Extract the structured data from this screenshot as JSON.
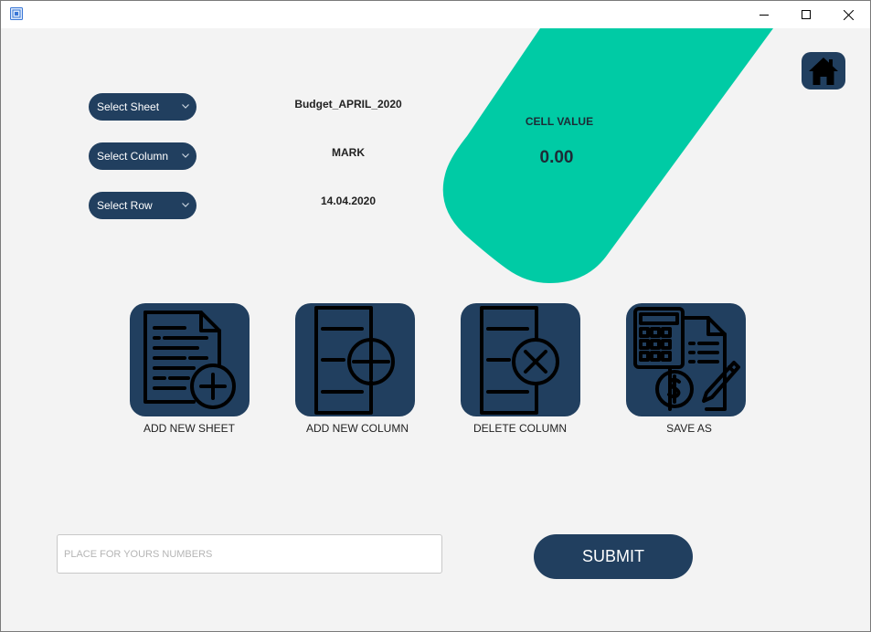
{
  "window": {
    "app_icon": "app-window-icon"
  },
  "selectors": [
    {
      "label": "Select Sheet",
      "value": "Budget_APRIL_2020"
    },
    {
      "label": "Select Column",
      "value": "MARK"
    },
    {
      "label": "Select Row",
      "value": "14.04.2020"
    }
  ],
  "cell": {
    "title": "CELL VALUE",
    "value": "0.00"
  },
  "actions": [
    {
      "label": "ADD NEW SHEET",
      "icon": "document-add-icon"
    },
    {
      "label": "ADD NEW COLUMN",
      "icon": "column-add-icon"
    },
    {
      "label": "DELETE COLUMN",
      "icon": "column-delete-icon"
    },
    {
      "label": "SAVE AS",
      "icon": "calculator-invoice-icon"
    }
  ],
  "input": {
    "placeholder": "PLACE FOR YOURS NUMBERS",
    "value": ""
  },
  "submit": {
    "label": "SUBMIT"
  },
  "colors": {
    "accent": "#00cba5",
    "primary": "#213f5f",
    "background": "#f3f3f3"
  }
}
